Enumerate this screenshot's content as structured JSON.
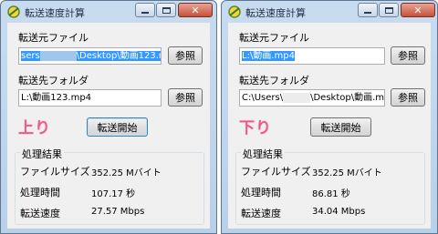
{
  "windows": [
    {
      "title": "転送速度計算",
      "source_label": "転送元ファイル",
      "source_value_selected": "sers",
      "source_value_blur": "　　　　",
      "source_value_rest": "\\Desktop\\動画123.mp4",
      "source_button": "参照",
      "dest_label": "転送先フォルダ",
      "dest_value": "L:\\動画123.mp4",
      "dest_button": "参照",
      "direction": "上り",
      "start_button": "転送開始",
      "results_title": "処理結果",
      "rows": [
        {
          "key": "ファイルサイズ",
          "value": "352.25 Mバイト"
        },
        {
          "key": "処理時間",
          "value": "107.17 秒"
        },
        {
          "key": "転送速度",
          "value": "27.57 Mbps"
        }
      ]
    },
    {
      "title": "転送速度計算",
      "source_label": "転送元ファイル",
      "source_value_selected": "L:\\動画.mp4",
      "source_button": "参照",
      "dest_label": "転送先フォルダ",
      "dest_value_pre": "C:\\Users\\",
      "dest_value_blur": "　　　",
      "dest_value_rest": "\\Desktop\\動画.mp",
      "dest_button": "参照",
      "direction": "下り",
      "start_button": "転送開始",
      "results_title": "処理結果",
      "rows": [
        {
          "key": "ファイルサイズ",
          "value": "352.25 Mバイト"
        },
        {
          "key": "処理時間",
          "value": "86.81 秒"
        },
        {
          "key": "転送速度",
          "value": "34.04 Mbps"
        }
      ]
    }
  ],
  "colors": {
    "accent_text": "#e85c8a",
    "selection": "#3399ff",
    "title_bar": "#c9dcef"
  }
}
